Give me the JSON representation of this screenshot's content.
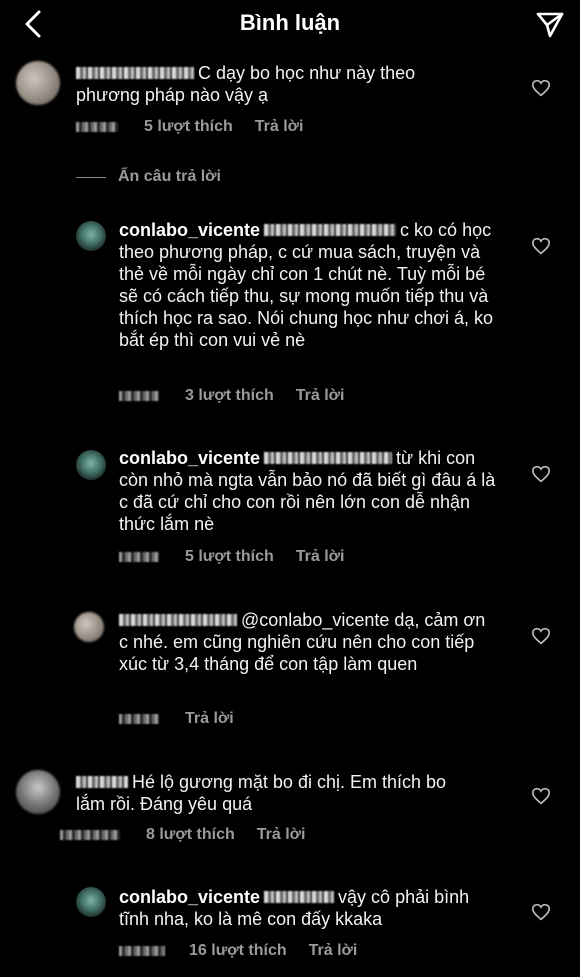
{
  "header": {
    "title": "Bình luận"
  },
  "comments": [
    {
      "username": "",
      "text": "C dạy bo học như này theo phương pháp nào vậy ạ",
      "likes": "5 lượt thích",
      "reply": "Trả lời"
    },
    {
      "username": "conlabo_vicente",
      "text": "c ko có học theo phương pháp, c cứ mua sách, truyện và thẻ về mỗi ngày chỉ con 1 chút nè. Tuỳ mỗi bé sẽ có cách tiếp thu, sự mong muốn tiếp thu và thích học ra sao. Nói chung học như chơi á, ko bắt ép thì con vui vẻ nè",
      "likes": "3 lượt thích",
      "reply": "Trả lời"
    },
    {
      "username": "conlabo_vicente",
      "text": "từ khi con còn nhỏ mà ngta vẫn bảo nó đã biết gì đâu á là c đã cứ chỉ cho con rồi nên lớn con dễ nhận thức lắm nè",
      "likes": "5 lượt thích",
      "reply": "Trả lời"
    },
    {
      "username": "",
      "text": "@conlabo_vicente dạ, cảm ơn c nhé. em cũng nghiên cứu nên cho con tiếp xúc từ 3,4 tháng để con tập làm quen",
      "likes": "",
      "reply": "Trả lời"
    },
    {
      "username": "",
      "text": "Hé lộ gương mặt bo đi chị. Em thích bo lắm rồi. Đáng yêu quá",
      "likes": "8 lượt thích",
      "reply": "Trả lời"
    },
    {
      "username": "conlabo_vicente",
      "text": "vậy cô phải bình tĩnh nha, ko là mê con đấy kkaka",
      "likes": "16 lượt thích",
      "reply": "Trả lời"
    }
  ],
  "hide_replies": "Ẩn câu trả lời",
  "icons": {
    "back": "chevron-left-icon",
    "send": "send-icon",
    "like": "heart-icon"
  }
}
